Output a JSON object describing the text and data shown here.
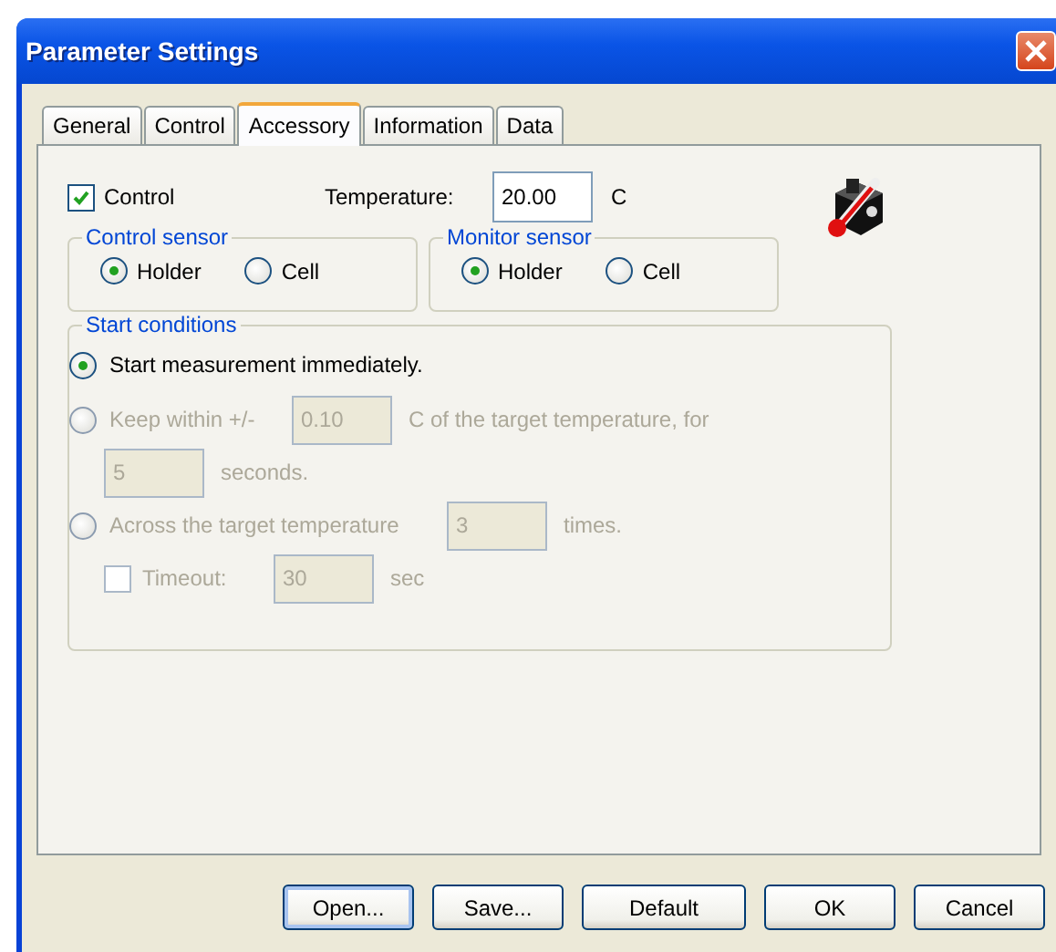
{
  "window": {
    "title": "Parameter Settings"
  },
  "tabs": [
    {
      "label": "General",
      "selected": false
    },
    {
      "label": "Control",
      "selected": false
    },
    {
      "label": "Accessory",
      "selected": true
    },
    {
      "label": "Information",
      "selected": false
    },
    {
      "label": "Data",
      "selected": false
    }
  ],
  "control": {
    "label": "Control",
    "checked": true
  },
  "temperature": {
    "label": "Temperature:",
    "value": "20.00",
    "unit": "C"
  },
  "sensor_groups": [
    {
      "title": "Control sensor",
      "options": [
        {
          "label": "Holder",
          "selected": true
        },
        {
          "label": "Cell",
          "selected": false
        }
      ]
    },
    {
      "title": "Monitor sensor",
      "options": [
        {
          "label": "Holder",
          "selected": true
        },
        {
          "label": "Cell",
          "selected": false
        }
      ]
    }
  ],
  "start_conditions": {
    "title": "Start conditions",
    "options": [
      {
        "kind": "immediate",
        "selected": true,
        "disabled": false,
        "label": "Start measurement immediately."
      },
      {
        "kind": "tolerance",
        "selected": false,
        "disabled": true,
        "label": "Keep within +/-",
        "value": "0.10",
        "suffix": "C of the target temperature, for",
        "duration": "5",
        "duration_unit": "seconds."
      },
      {
        "kind": "crossing",
        "selected": false,
        "disabled": true,
        "label": "Across the target temperature",
        "value": "3",
        "suffix": "times.",
        "timeout": {
          "label": "Timeout:",
          "checked": false,
          "value": "30",
          "unit": "sec"
        }
      }
    ]
  },
  "buttons": [
    {
      "label": "Open...",
      "focused": true
    },
    {
      "label": "Save...",
      "focused": false
    },
    {
      "label": "Default",
      "focused": false
    },
    {
      "label": "OK",
      "focused": false
    },
    {
      "label": "Cancel",
      "focused": false
    }
  ]
}
